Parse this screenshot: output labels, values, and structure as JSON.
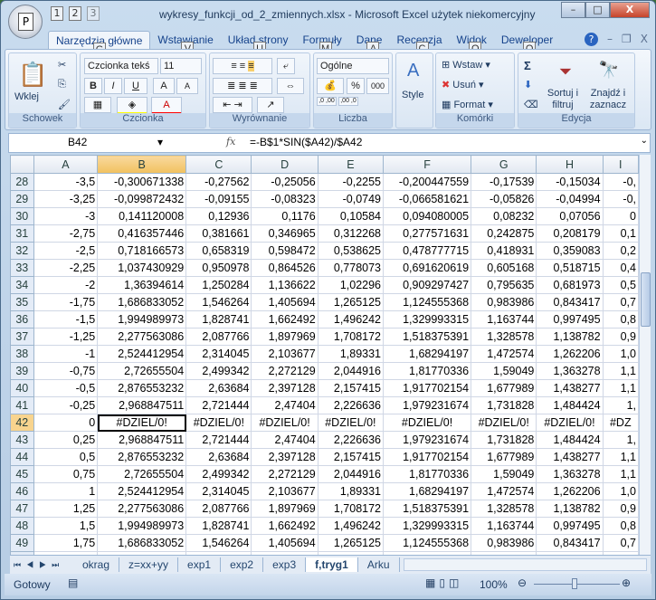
{
  "window": {
    "title": "wykresy_funkcji_od_2_zmiennych.xlsx - Microsoft Excel użytek niekomercyjny",
    "office_key": "P",
    "qat_keys": [
      "1",
      "2",
      "3"
    ],
    "minimize": "–",
    "maximize": "□",
    "close": "X"
  },
  "tabs": [
    {
      "label": "Narzędzia główne",
      "key": "G",
      "active": true
    },
    {
      "label": "Wstawianie",
      "key": "V"
    },
    {
      "label": "Układ strony",
      "key": "U"
    },
    {
      "label": "Formuły",
      "key": "M"
    },
    {
      "label": "Dane",
      "key": "A"
    },
    {
      "label": "Recenzja",
      "key": "C"
    },
    {
      "label": "Widok",
      "key": "O"
    },
    {
      "label": "Deweloper",
      "key": "Q"
    }
  ],
  "ribbon": {
    "clipboard": {
      "label": "Schowek",
      "paste": "Wklej"
    },
    "font": {
      "label": "Czcionka",
      "name": "Czcionka tekś",
      "size": "11",
      "bold": "B",
      "italic": "I",
      "underline": "U",
      "grow": "A",
      "shrink": "A",
      "color": "A",
      "fill_color": "#ffff00",
      "font_color": "#ff0000"
    },
    "alignment": {
      "label": "Wyrównanie"
    },
    "number": {
      "label": "Liczba",
      "format": "Ogólne",
      "percent": "%",
      "thousands": "000",
      "inc": ",0 ,00",
      "dec": ",00 ,0"
    },
    "styles": {
      "label": "Style"
    },
    "cells": {
      "label": "Komórki",
      "insert": "Wstaw",
      "delete": "Usuń",
      "format": "Format"
    },
    "editing": {
      "label": "Edycja",
      "sigma": "Σ",
      "sort": "Sortuj i filtruj",
      "find": "Znajdź i zaznacz"
    }
  },
  "formula_bar": {
    "name_box": "B42",
    "fx": "fx",
    "formula": "=-B$1*SIN($A42)/$A42"
  },
  "columns": [
    "A",
    "B",
    "C",
    "D",
    "E",
    "F",
    "G",
    "H",
    "I"
  ],
  "selected_column": "B",
  "selected_row": "42",
  "rows": [
    [
      "28",
      "-3,5",
      "-0,300671338",
      "-0,27562",
      "-0,25056",
      "-0,2255",
      "-0,200447559",
      "-0,17539",
      "-0,15034",
      "-0,"
    ],
    [
      "29",
      "-3,25",
      "-0,099872432",
      "-0,09155",
      "-0,08323",
      "-0,0749",
      "-0,066581621",
      "-0,05826",
      "-0,04994",
      "-0,"
    ],
    [
      "30",
      "-3",
      "0,141120008",
      "0,12936",
      "0,1176",
      "0,10584",
      "0,094080005",
      "0,08232",
      "0,07056",
      "0"
    ],
    [
      "31",
      "-2,75",
      "0,416357446",
      "0,381661",
      "0,346965",
      "0,312268",
      "0,277571631",
      "0,242875",
      "0,208179",
      "0,1"
    ],
    [
      "32",
      "-2,5",
      "0,718166573",
      "0,658319",
      "0,598472",
      "0,538625",
      "0,478777715",
      "0,418931",
      "0,359083",
      "0,2"
    ],
    [
      "33",
      "-2,25",
      "1,037430929",
      "0,950978",
      "0,864526",
      "0,778073",
      "0,691620619",
      "0,605168",
      "0,518715",
      "0,4"
    ],
    [
      "34",
      "-2",
      "1,36394614",
      "1,250284",
      "1,136622",
      "1,02296",
      "0,909297427",
      "0,795635",
      "0,681973",
      "0,5"
    ],
    [
      "35",
      "-1,75",
      "1,686833052",
      "1,546264",
      "1,405694",
      "1,265125",
      "1,124555368",
      "0,983986",
      "0,843417",
      "0,7"
    ],
    [
      "36",
      "-1,5",
      "1,994989973",
      "1,828741",
      "1,662492",
      "1,496242",
      "1,329993315",
      "1,163744",
      "0,997495",
      "0,8"
    ],
    [
      "37",
      "-1,25",
      "2,277563086",
      "2,087766",
      "1,897969",
      "1,708172",
      "1,518375391",
      "1,328578",
      "1,138782",
      "0,9"
    ],
    [
      "38",
      "-1",
      "2,524412954",
      "2,314045",
      "2,103677",
      "1,89331",
      "1,68294197",
      "1,472574",
      "1,262206",
      "1,0"
    ],
    [
      "39",
      "-0,75",
      "2,72655504",
      "2,499342",
      "2,272129",
      "2,044916",
      "1,81770336",
      "1,59049",
      "1,363278",
      "1,1"
    ],
    [
      "40",
      "-0,5",
      "2,876553232",
      "2,63684",
      "2,397128",
      "2,157415",
      "1,917702154",
      "1,677989",
      "1,438277",
      "1,1"
    ],
    [
      "41",
      "-0,25",
      "2,968847511",
      "2,721444",
      "2,47404",
      "2,226636",
      "1,979231674",
      "1,731828",
      "1,484424",
      "1,"
    ],
    [
      "42",
      "0",
      "#DZIEL/0!",
      "#DZIEL/0!",
      "#DZIEL/0!",
      "#DZIEL/0!",
      "#DZIEL/0!",
      "#DZIEL/0!",
      "#DZIEL/0!",
      "#DZ"
    ],
    [
      "43",
      "0,25",
      "2,968847511",
      "2,721444",
      "2,47404",
      "2,226636",
      "1,979231674",
      "1,731828",
      "1,484424",
      "1,"
    ],
    [
      "44",
      "0,5",
      "2,876553232",
      "2,63684",
      "2,397128",
      "2,157415",
      "1,917702154",
      "1,677989",
      "1,438277",
      "1,1"
    ],
    [
      "45",
      "0,75",
      "2,72655504",
      "2,499342",
      "2,272129",
      "2,044916",
      "1,81770336",
      "1,59049",
      "1,363278",
      "1,1"
    ],
    [
      "46",
      "1",
      "2,524412954",
      "2,314045",
      "2,103677",
      "1,89331",
      "1,68294197",
      "1,472574",
      "1,262206",
      "1,0"
    ],
    [
      "47",
      "1,25",
      "2,277563086",
      "2,087766",
      "1,897969",
      "1,708172",
      "1,518375391",
      "1,328578",
      "1,138782",
      "0,9"
    ],
    [
      "48",
      "1,5",
      "1,994989973",
      "1,828741",
      "1,662492",
      "1,496242",
      "1,329993315",
      "1,163744",
      "0,997495",
      "0,8"
    ],
    [
      "49",
      "1,75",
      "1,686833052",
      "1,546264",
      "1,405694",
      "1,265125",
      "1,124555368",
      "0,983986",
      "0,843417",
      "0,7"
    ],
    [
      "50",
      "2",
      "1,36394614",
      "1,250284",
      "1,136622",
      "1,02296",
      "0,909297427",
      "0,795635",
      "0,681973",
      "0,5"
    ]
  ],
  "sheets": [
    {
      "label": "okrag"
    },
    {
      "label": "z=xx+yy"
    },
    {
      "label": "exp1"
    },
    {
      "label": "exp2"
    },
    {
      "label": "exp3"
    },
    {
      "label": "f,tryg1",
      "active": true
    },
    {
      "label": "Arku"
    }
  ],
  "status": {
    "ready": "Gotowy",
    "zoom": "100%"
  }
}
